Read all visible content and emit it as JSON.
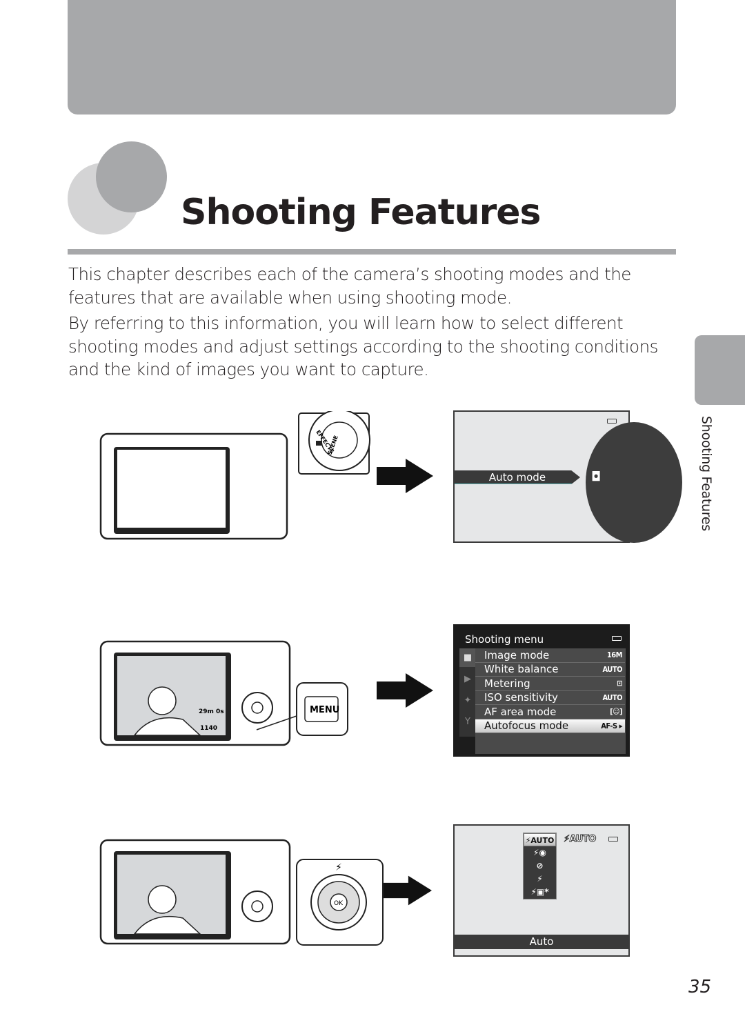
{
  "page": {
    "title": "Shooting Features",
    "side_tab": "Shooting Features",
    "page_number": "35",
    "paragraphs": [
      "This chapter describes each of the camera’s shooting modes and the features that are available when using shooting mode.",
      "By referring to this information, you will learn how to select different shooting modes and adjust settings according to the shooting conditions and the kind of images you want to capture."
    ]
  },
  "figure1": {
    "dial_labels": [
      "EFFECTS",
      "SCENE"
    ],
    "screen_label": "Auto mode",
    "mode_icons": [
      "continuous-icon",
      "smart-portrait-icon",
      "camera-icon",
      "scene-auto-icon",
      "scene-icon"
    ]
  },
  "figure2": {
    "button_label": "MENU",
    "menu_title": "Shooting menu",
    "items": [
      {
        "label": "Image mode",
        "value": "16M"
      },
      {
        "label": "White balance",
        "value": "AUTO"
      },
      {
        "label": "Metering",
        "value": "⊡"
      },
      {
        "label": "ISO sensitivity",
        "value": "AUTO"
      },
      {
        "label": "AF area mode",
        "value": "[☺]"
      },
      {
        "label": "Autofocus mode",
        "value": "AF-S ▸"
      }
    ],
    "selected_index": 5,
    "lcd": {
      "remaining_time": "29m 0s",
      "shots": "1140"
    }
  },
  "figure3": {
    "flash_options": [
      "⚡AUTO",
      "⚡◉",
      "⊘",
      "⚡",
      "⚡▣*"
    ],
    "current": "⚡AUTO",
    "bar_label": "Auto"
  },
  "colors": {
    "accent_gray": "#a7a8aa",
    "light_gray": "#d4d4d5",
    "screen_dark": "#3a3a3a"
  }
}
